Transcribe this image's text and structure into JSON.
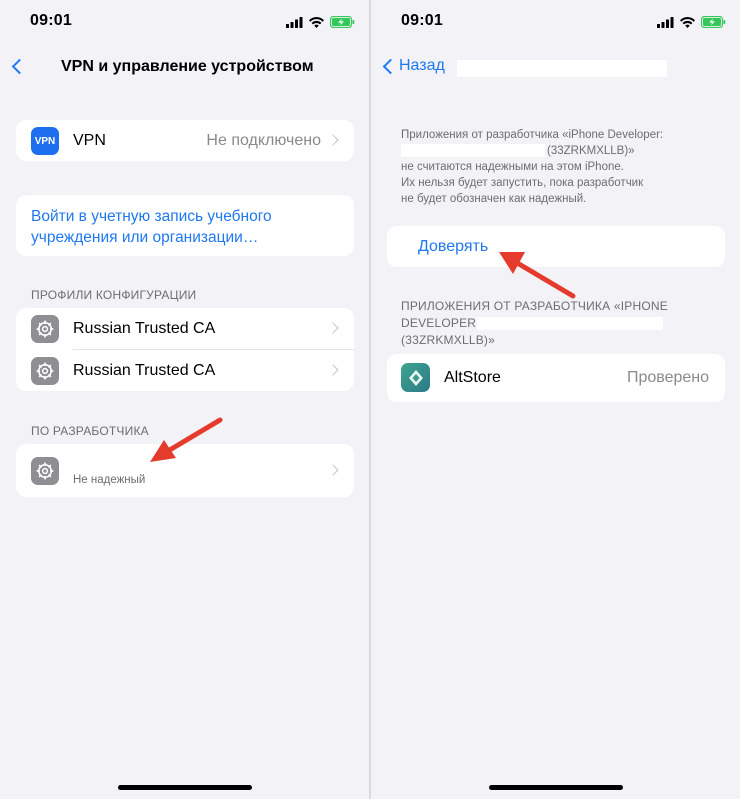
{
  "left": {
    "status": {
      "time": "09:01"
    },
    "nav": {
      "title": "VPN и управление устройством"
    },
    "vpn": {
      "icon_text": "VPN",
      "label": "VPN",
      "value": "Не подключено"
    },
    "signin": {
      "line1": "Войти в учетную запись учебного",
      "line2": "учреждения или организации…"
    },
    "profiles": {
      "header": "ПРОФИЛИ КОНФИГУРАЦИИ",
      "items": [
        {
          "label": "Russian Trusted CA"
        },
        {
          "label": "Russian Trusted CA"
        }
      ]
    },
    "developer": {
      "header": "ПО РАЗРАБОТЧИКА",
      "status": "Не надежный"
    }
  },
  "right": {
    "status": {
      "time": "09:01"
    },
    "nav": {
      "back_label": "Назад"
    },
    "info": {
      "line1": "Приложения от разработчика «iPhone Developer:",
      "line2": "(33ZRKMXLLB)»",
      "line3": "не считаются надежными на этом iPhone.",
      "line4": "Их нельзя будет запустить, пока разработчик",
      "line5": "не будет обозначен как надежный."
    },
    "trust": {
      "label": "Доверять"
    },
    "apps_header": {
      "line1": "ПРИЛОЖЕНИЯ ОТ РАЗРАБОТЧИКА «IPHONE",
      "line2": "DEVELOPER:",
      "line3": "(33ZRKMXLLB)»"
    },
    "app": {
      "name": "AltStore",
      "status": "Проверено"
    }
  },
  "colors": {
    "accent": "#1f78f0",
    "arrow": "#e53b2c",
    "background": "#f2f2f7"
  }
}
